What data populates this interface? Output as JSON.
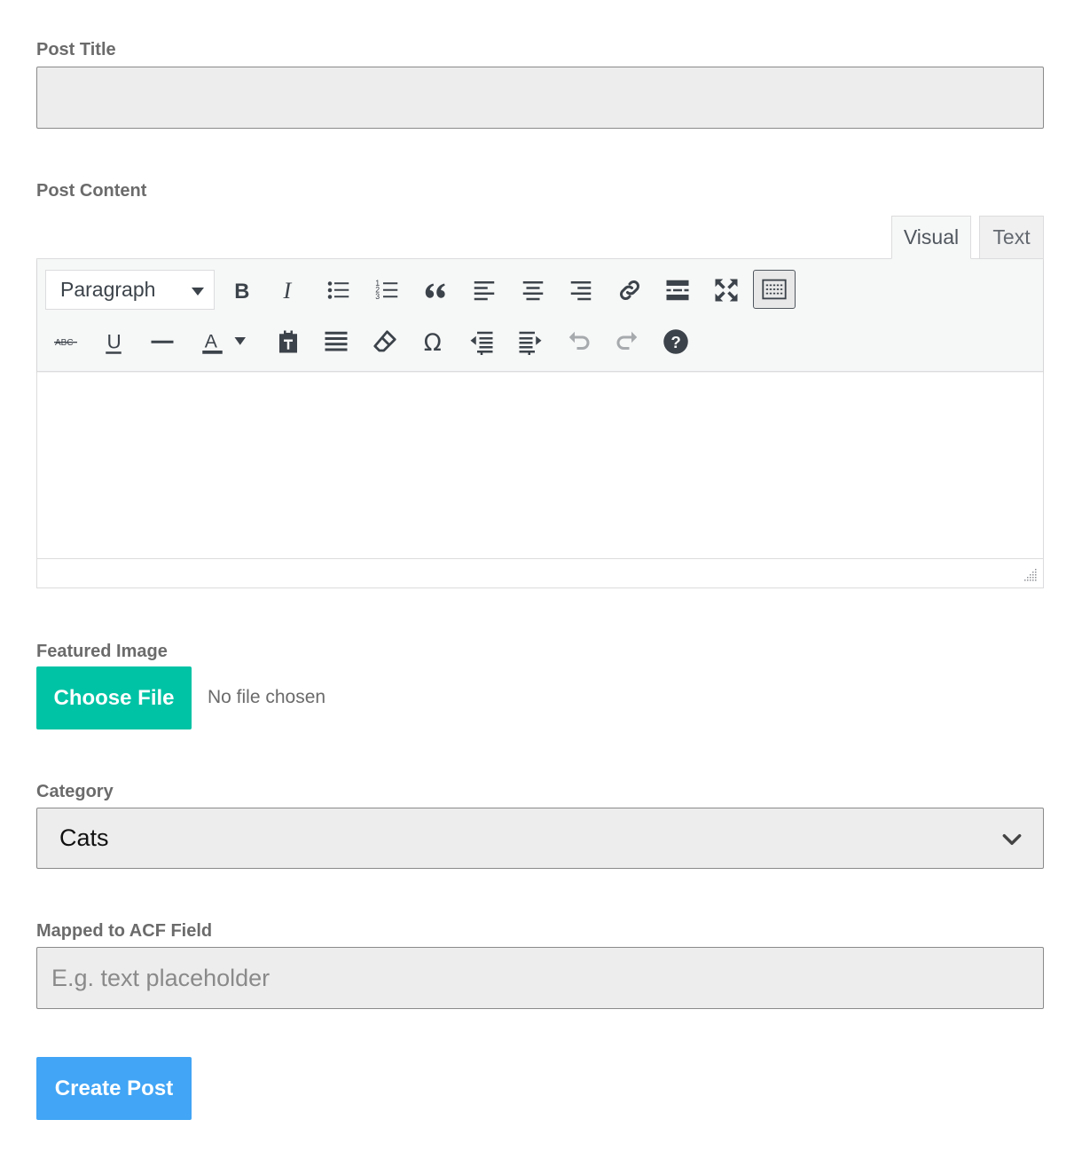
{
  "post_title": {
    "label": "Post Title",
    "value": ""
  },
  "post_content": {
    "label": "Post Content",
    "tabs": [
      {
        "label": "Visual",
        "active": true
      },
      {
        "label": "Text",
        "active": false
      }
    ],
    "format_select": "Paragraph",
    "toolbar_row1": [
      "bold-icon",
      "italic-icon",
      "bullet-list-icon",
      "numbered-list-icon",
      "blockquote-icon",
      "align-left-icon",
      "align-center-icon",
      "align-right-icon",
      "link-icon",
      "read-more-icon",
      "fullscreen-icon",
      "toolbar-toggle-icon"
    ],
    "toolbar_row2": [
      "strikethrough-icon",
      "underline-icon",
      "horizontal-line-icon",
      "text-color-icon",
      "paste-text-icon",
      "justify-icon",
      "clear-formatting-icon",
      "special-character-icon",
      "outdent-icon",
      "indent-icon",
      "undo-icon",
      "redo-icon",
      "help-icon"
    ],
    "strikethrough_glyph": "ABC",
    "underline_glyph": "U",
    "text_color_glyph": "A",
    "special_char_glyph": "Ω",
    "help_glyph": "?"
  },
  "featured_image": {
    "label": "Featured Image",
    "button_label": "Choose File",
    "status": "No file chosen"
  },
  "category": {
    "label": "Category",
    "selected": "Cats"
  },
  "acf_field": {
    "label": "Mapped to ACF Field",
    "placeholder": "E.g. text placeholder",
    "value": ""
  },
  "submit": {
    "label": "Create Post"
  },
  "colors": {
    "choose_file_button": "#00c3a5",
    "create_post_button": "#42a5f5",
    "input_background": "#ededed",
    "label_text": "#6b6b6b"
  }
}
